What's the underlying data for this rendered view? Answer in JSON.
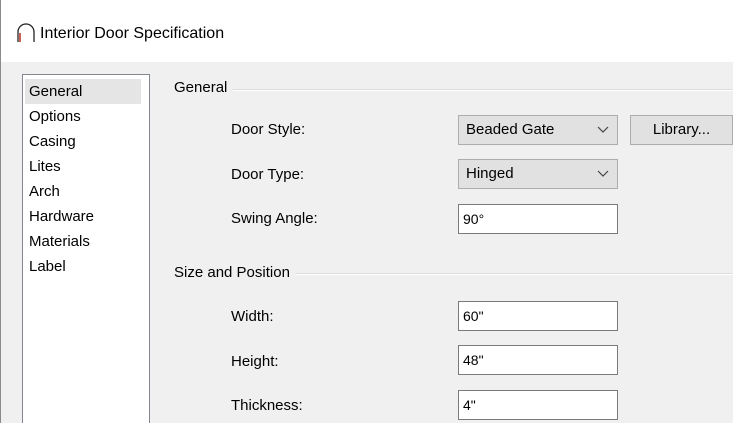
{
  "window": {
    "title": "Interior Door Specification",
    "icon": "door-arch-icon"
  },
  "sidebar": {
    "items": [
      {
        "label": "General",
        "selected": true
      },
      {
        "label": "Options",
        "selected": false
      },
      {
        "label": "Casing",
        "selected": false
      },
      {
        "label": "Lites",
        "selected": false
      },
      {
        "label": "Arch",
        "selected": false
      },
      {
        "label": "Hardware",
        "selected": false
      },
      {
        "label": "Materials",
        "selected": false
      },
      {
        "label": "Label",
        "selected": false
      }
    ]
  },
  "general": {
    "heading": "General",
    "door_style_label": "Door Style:",
    "door_style_value": "Beaded Gate",
    "library_button": "Library...",
    "door_type_label": "Door Type:",
    "door_type_value": "Hinged",
    "swing_angle_label": "Swing Angle:",
    "swing_angle_value": "90°"
  },
  "size_position": {
    "heading": "Size and Position",
    "width_label": "Width:",
    "width_value": "60\"",
    "height_label": "Height:",
    "height_value": "48\"",
    "thickness_label": "Thickness:",
    "thickness_value": "4\""
  },
  "colors": {
    "title_icon": "#c0392b",
    "selection": "#e5e5e5",
    "dialog_bg": "#f0f0f0"
  }
}
